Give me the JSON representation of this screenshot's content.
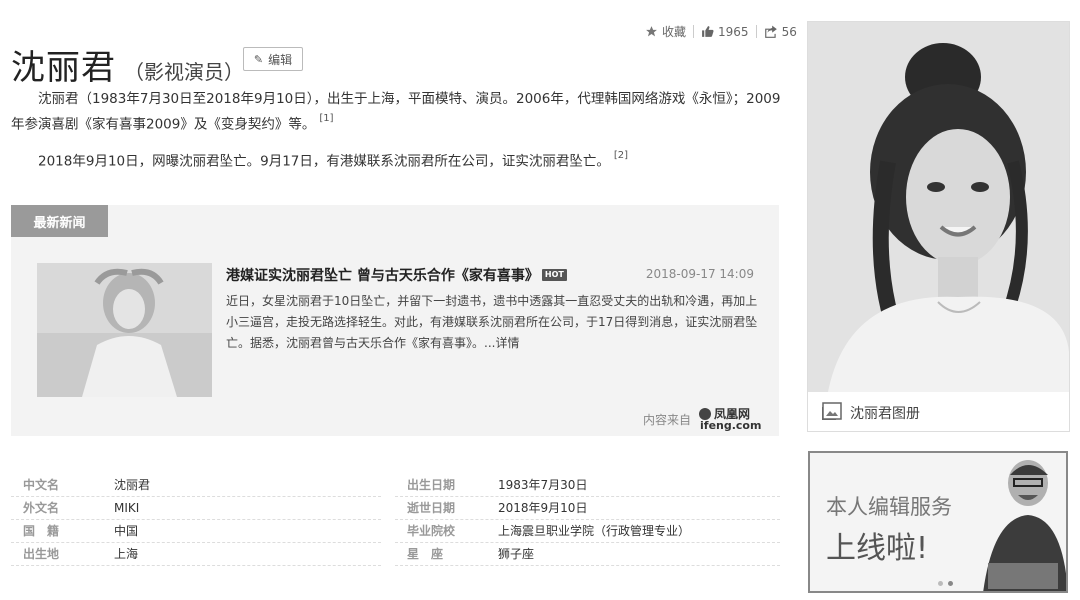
{
  "actions": {
    "favorite_label": "收藏",
    "like_count": "1965",
    "share_count": "56"
  },
  "header": {
    "name": "沈丽君",
    "subtitle": "（影视演员）",
    "edit_label": "编辑"
  },
  "intro": {
    "para1_line1": "沈丽君（1983年7月30日至2018年9月10日），出生于上海，平面模特、演员。2006年，代理韩国网络游戏《永恒》；2009",
    "para1_line2": "年参演喜剧《家有喜事2009》及《变身契约》等。",
    "para1_ref": "[1]",
    "para2": "2018年9月10日，网曝沈丽君坠亡。9月17日，有港媒联系沈丽君所在公司，证实沈丽君坠亡。",
    "para2_ref": "[2]"
  },
  "news": {
    "tab_label": "最新新闻",
    "title": "港媒证实沈丽君坠亡 曾与古天乐合作《家有喜事》",
    "hot_badge": "HOT",
    "date": "2018-09-17 14:09",
    "body": "近日，女星沈丽君于10日坠亡，并留下一封遗书，遗书中透露其一直忍受丈夫的出轨和冷遇，再加上小三逼宫，走投无路选择轻生。对此，有港媒联系沈丽君所在公司，于17日得到消息，证实沈丽君坠亡。据悉，沈丽君曾与古天乐合作《家有喜事》。...详情",
    "source_label": "内容来自",
    "source_logo_cn": "凤凰网",
    "source_logo_en": "ifeng.com"
  },
  "info": {
    "left": [
      {
        "key": "中文名",
        "value": "沈丽君"
      },
      {
        "key": "外文名",
        "value": "MIKI"
      },
      {
        "key": "国　籍",
        "value": "中国"
      },
      {
        "key": "出生地",
        "value": "上海"
      }
    ],
    "right": [
      {
        "key": "出生日期",
        "value": "1983年7月30日"
      },
      {
        "key": "逝世日期",
        "value": "2018年9月10日"
      },
      {
        "key": "毕业院校",
        "value": "上海震旦职业学院（行政管理专业）"
      },
      {
        "key": "星　座",
        "value": "狮子座"
      }
    ]
  },
  "sidebar": {
    "album_label": "沈丽君图册",
    "ad_line1": "本人编辑服务",
    "ad_line2": "上线啦!"
  }
}
